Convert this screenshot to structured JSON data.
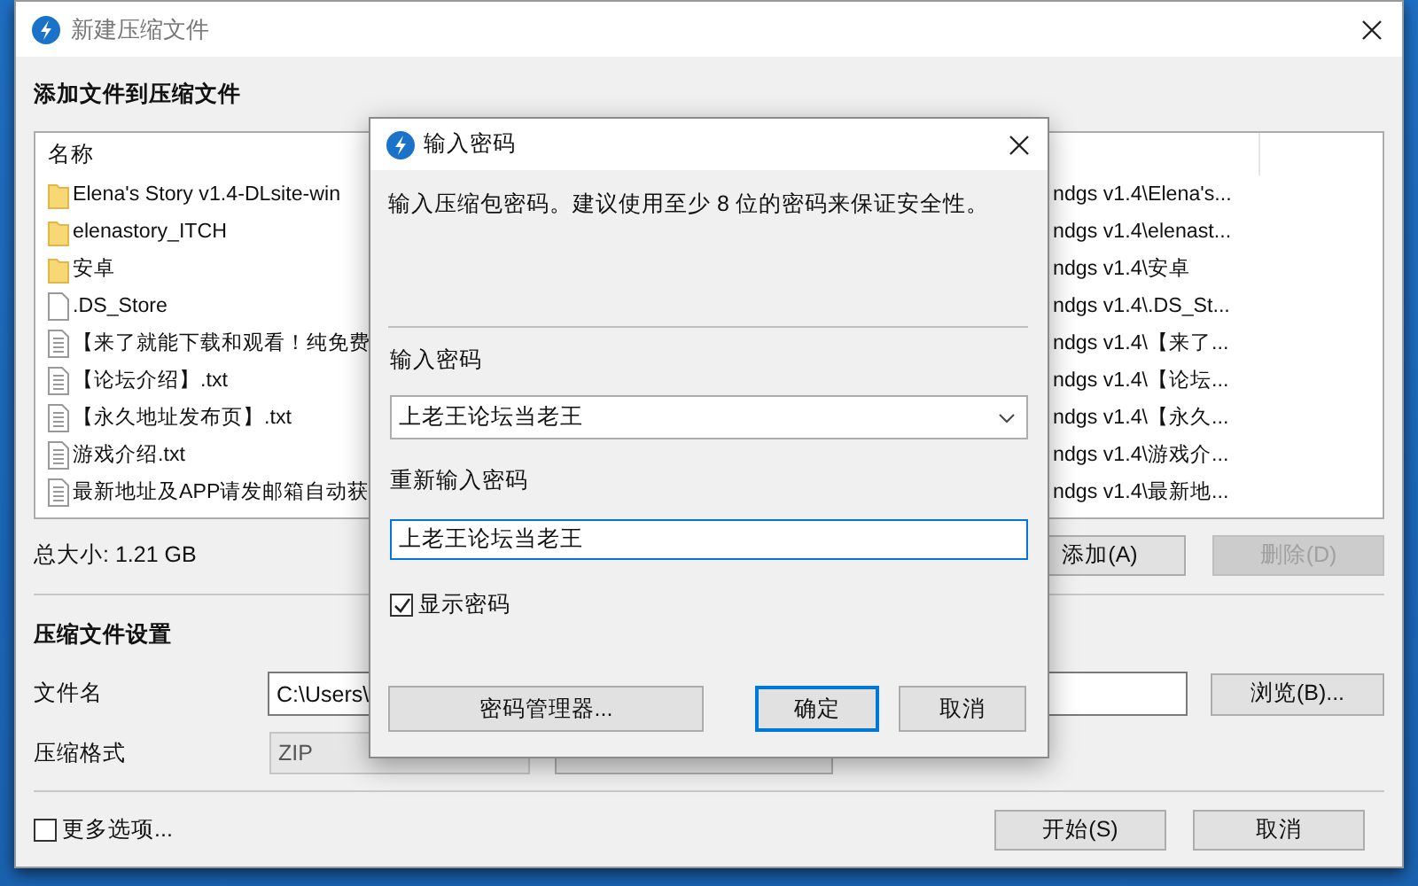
{
  "window": {
    "title": "新建压缩文件"
  },
  "files": {
    "heading": "添加文件到压缩文件",
    "columns": [
      "名称"
    ],
    "rows": [
      {
        "kind": "folder",
        "name": "Elena's Story v1.4-DLsite-win",
        "column_2": "ndgs v1.4\\Elena's..."
      },
      {
        "kind": "folder",
        "name": "elenastory_ITCH",
        "column_2": "ndgs v1.4\\elenast..."
      },
      {
        "kind": "folder",
        "name": "安卓",
        "column_2": "ndgs v1.4\\安卓"
      },
      {
        "kind": "file",
        "name": ".DS_Store",
        "column_2": "ndgs v1.4\\.DS_St..."
      },
      {
        "kind": "text",
        "name": "【来了就能下载和观看！纯免费",
        "column_2": "ndgs v1.4\\【来了..."
      },
      {
        "kind": "text",
        "name": "【论坛介绍】.txt",
        "column_2": "ndgs v1.4\\【论坛..."
      },
      {
        "kind": "text",
        "name": "【永久地址发布页】.txt",
        "column_2": "ndgs v1.4\\【永久..."
      },
      {
        "kind": "text",
        "name": "游戏介绍.txt",
        "column_2": "ndgs v1.4\\游戏介..."
      },
      {
        "kind": "text",
        "name": "最新地址及APP请发邮箱自动获",
        "column_2": "ndgs v1.4\\最新地..."
      }
    ],
    "total_size": "总大小: 1.21 GB",
    "buttons": [
      {
        "label": "添加(A)",
        "disabled": false
      },
      {
        "label": "删除(D)",
        "disabled": true
      }
    ]
  },
  "settings": {
    "heading": "压缩文件设置",
    "filename_label": "文件名",
    "filename_value": "C:\\Users\\",
    "browse_button": "浏览(B)...",
    "format_label": "压缩格式",
    "format_value": "ZIP"
  },
  "more_options": {
    "label": "更多选项...",
    "checked": false
  },
  "buttons": [
    "开始(S)",
    "取消"
  ],
  "dialog": {
    "title": "输入密码",
    "message": "输入压缩包密码。建议使用至少 8 位的密码来保证安全性。",
    "password_label": "输入密码",
    "password_value": "上老王论坛当老王",
    "confirm_label": "重新输入密码",
    "confirm_value": "上老王论坛当老王",
    "show_password": {
      "label": "显示密码",
      "checked": true
    },
    "buttons": [
      {
        "label": "密码管理器...",
        "default": false
      },
      {
        "label": "确定",
        "default": true
      },
      {
        "label": "取消",
        "default": false
      }
    ]
  }
}
